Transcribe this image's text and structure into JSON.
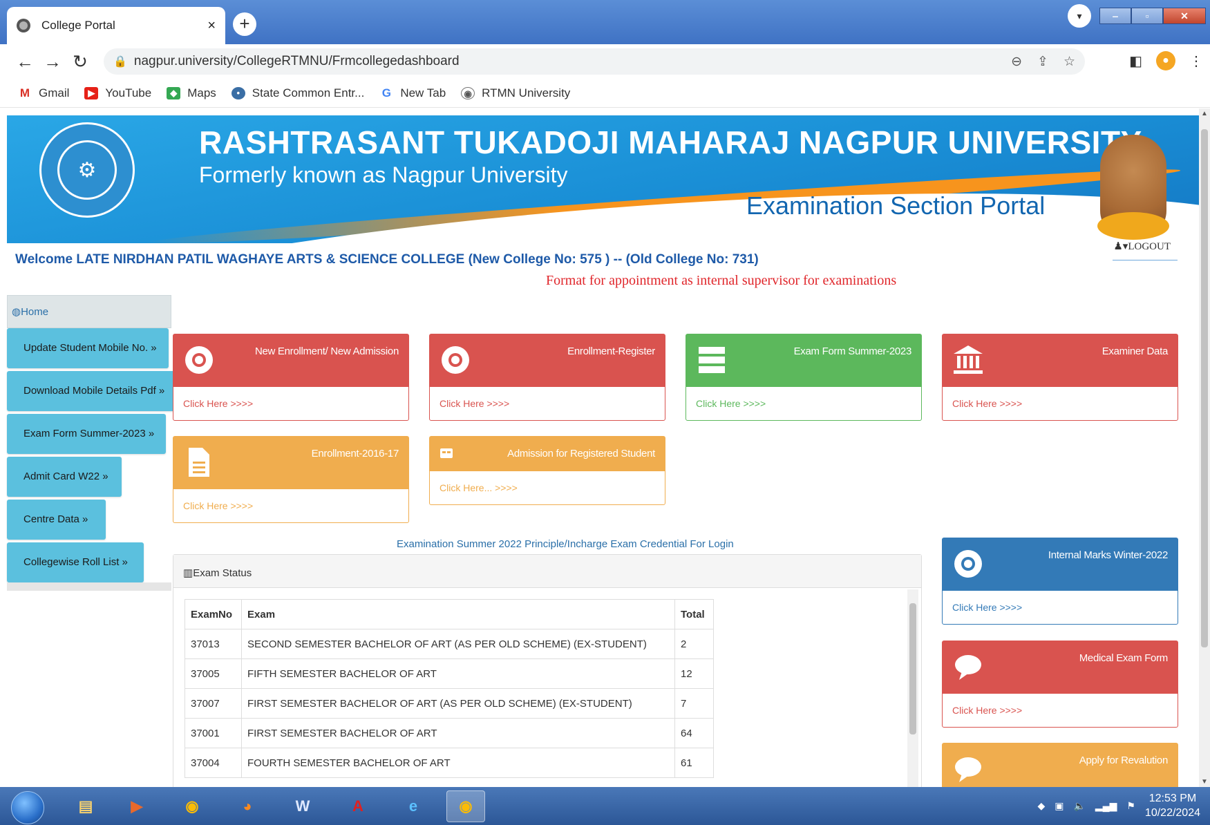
{
  "browser": {
    "tab_title": "College Portal",
    "tab_close": "×",
    "new_tab": "+",
    "url": "nagpur.university/CollegeRTMNU/Frmcollegedashboard",
    "bookmarks": [
      "Gmail",
      "YouTube",
      "Maps",
      "State Common Entr...",
      "New Tab",
      "RTMN University"
    ]
  },
  "header": {
    "university": "RASHTRASANT TUKADOJI MAHARAJ NAGPUR UNIVERSITY",
    "formerly": "Formerly known as Nagpur University",
    "portal": "Examination Section Portal",
    "welcome": "Welcome LATE NIRDHAN PATIL WAGHAYE ARTS & SCIENCE COLLEGE (New College No: 575 ) -- (Old College No: 731)",
    "logout": "LOGOUT"
  },
  "sidebar": {
    "home": "Home",
    "items": [
      "Update Student Mobile No. »",
      "Download Mobile Details Pdf »",
      "Exam Form Summer-2023 »",
      "Admit Card W22 »",
      "Centre Data »",
      "Collegewise Roll List »"
    ]
  },
  "notice": "Format for appointment as internal supervisor for examinations",
  "cards": {
    "new_enrollment": {
      "title": "New Enrollment/ New Admission",
      "link": "Click Here >>>>"
    },
    "enrollment_register": {
      "title": "Enrollment-Register",
      "link": "Click Here >>>>"
    },
    "exam_form": {
      "title": "Exam Form Summer-2023",
      "link": "Click Here >>>>"
    },
    "examiner_data": {
      "title": "Examiner Data",
      "link": "Click Here >>>>"
    },
    "enrollment_2016": {
      "title": "Enrollment-2016-17",
      "link": "Click Here >>>>"
    },
    "admission_registered": {
      "title": "Admission for Registered Student",
      "link": "Click Here... >>>>"
    },
    "internal_marks": {
      "title": "Internal Marks Winter-2022",
      "link": "Click Here >>>>"
    },
    "medical_exam": {
      "title": "Medical Exam Form",
      "link": "Click Here >>>>"
    },
    "revaluation": {
      "title": "Apply for Revalution"
    }
  },
  "credential_link": "Examination Summer 2022 Principle/Incharge Exam Credential For Login",
  "exam_status": {
    "title": "Exam Status",
    "columns": [
      "ExamNo",
      "Exam",
      "Total"
    ],
    "rows": [
      [
        "37013",
        "SECOND SEMESTER BACHELOR OF ART (AS PER OLD SCHEME) (EX-STUDENT)",
        "2"
      ],
      [
        "37005",
        "FIFTH SEMESTER BACHELOR OF ART",
        "12"
      ],
      [
        "37007",
        "FIRST SEMESTER BACHELOR OF ART (AS PER OLD SCHEME) (EX-STUDENT)",
        "7"
      ],
      [
        "37001",
        "FIRST SEMESTER BACHELOR OF ART",
        "64"
      ],
      [
        "37004",
        "FOURTH SEMESTER BACHELOR OF ART",
        "61"
      ]
    ]
  },
  "taskbar": {
    "time": "12:53 PM",
    "date": "10/22/2024"
  },
  "colors": {
    "danger": "#d9534f",
    "success": "#5cb85c",
    "warning": "#f0ad4e",
    "primary": "#337ab7",
    "info": "#5bc0de"
  }
}
